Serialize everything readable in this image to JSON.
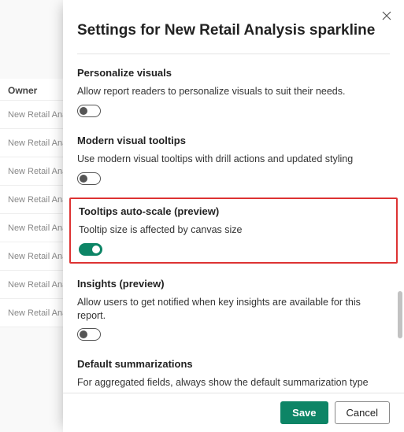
{
  "background": {
    "header": "Owner",
    "rows": [
      "New Retail Ana",
      "New Retail Ana",
      "New Retail Ana",
      "New Retail Ana",
      "New Retail Ana",
      "New Retail Ana",
      "New Retail Ana",
      "New Retail Ana"
    ]
  },
  "panel": {
    "title": "Settings for New Retail Analysis sparkline",
    "sections": {
      "personalize": {
        "title": "Personalize visuals",
        "desc": "Allow report readers to personalize visuals to suit their needs."
      },
      "modern_tooltips": {
        "title": "Modern visual tooltips",
        "desc": "Use modern visual tooltips with drill actions and updated styling"
      },
      "tooltips_autoscale": {
        "title": "Tooltips auto-scale (preview)",
        "desc": "Tooltip size is affected by canvas size"
      },
      "insights": {
        "title": "Insights (preview)",
        "desc": "Allow users to get notified when key insights are available for this report."
      },
      "default_summ": {
        "title": "Default summarizations",
        "desc": "For aggregated fields, always show the default summarization type"
      }
    },
    "buttons": {
      "save": "Save",
      "cancel": "Cancel"
    }
  }
}
